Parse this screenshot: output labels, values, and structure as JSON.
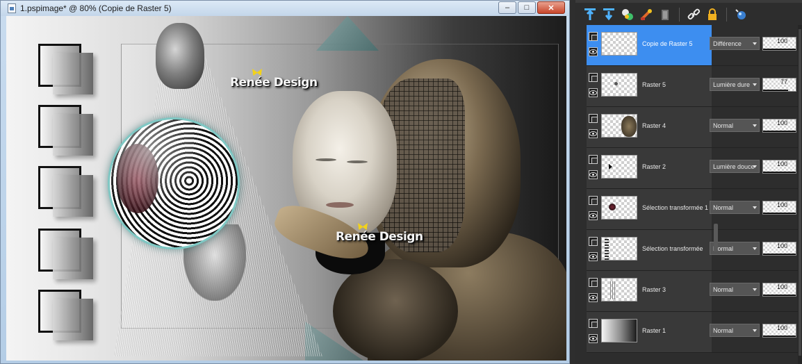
{
  "window": {
    "title": "1.pspimage* @  80% (Copie de Raster 5)",
    "minimize_glyph": "–",
    "maximize_glyph": "□",
    "close_glyph": "✕"
  },
  "canvas": {
    "watermark_1": "Renée Design",
    "watermark_2": "Renée Design",
    "accent_teal": "#7fc8c4",
    "butterfly_color": "#f2d21b"
  },
  "toolbar_icons": [
    "new-raster-layer-icon",
    "new-vector-layer-icon",
    "new-adjustment-layer-icon",
    "new-mask-layer-icon",
    "delete-layer-icon",
    "link-icon",
    "lock-icon",
    "layer-style-icon"
  ],
  "layers": [
    {
      "name": "Copie de Raster 5",
      "blend": "Différence",
      "opacity": "100",
      "selected": true
    },
    {
      "name": "Raster 5",
      "blend": "Lumière dure",
      "opacity": "77",
      "selected": false
    },
    {
      "name": "Raster 4",
      "blend": "Normal",
      "opacity": "100",
      "selected": false
    },
    {
      "name": "Raster 2",
      "blend": "Lumière douce",
      "opacity": "100",
      "selected": false
    },
    {
      "name": "Sélection transformée 1",
      "blend": "Normal",
      "opacity": "100",
      "selected": false
    },
    {
      "name": "Sélection transformée",
      "blend": "Normal",
      "opacity": "100",
      "selected": false
    },
    {
      "name": "Raster 3",
      "blend": "Normal",
      "opacity": "100",
      "selected": false
    },
    {
      "name": "Raster 1",
      "blend": "Normal",
      "opacity": "100",
      "selected": false
    }
  ],
  "colors": {
    "selected_layer": "#3d8ef0",
    "panel_bg": "#2d2d2d",
    "close_button": "#c7452a"
  }
}
